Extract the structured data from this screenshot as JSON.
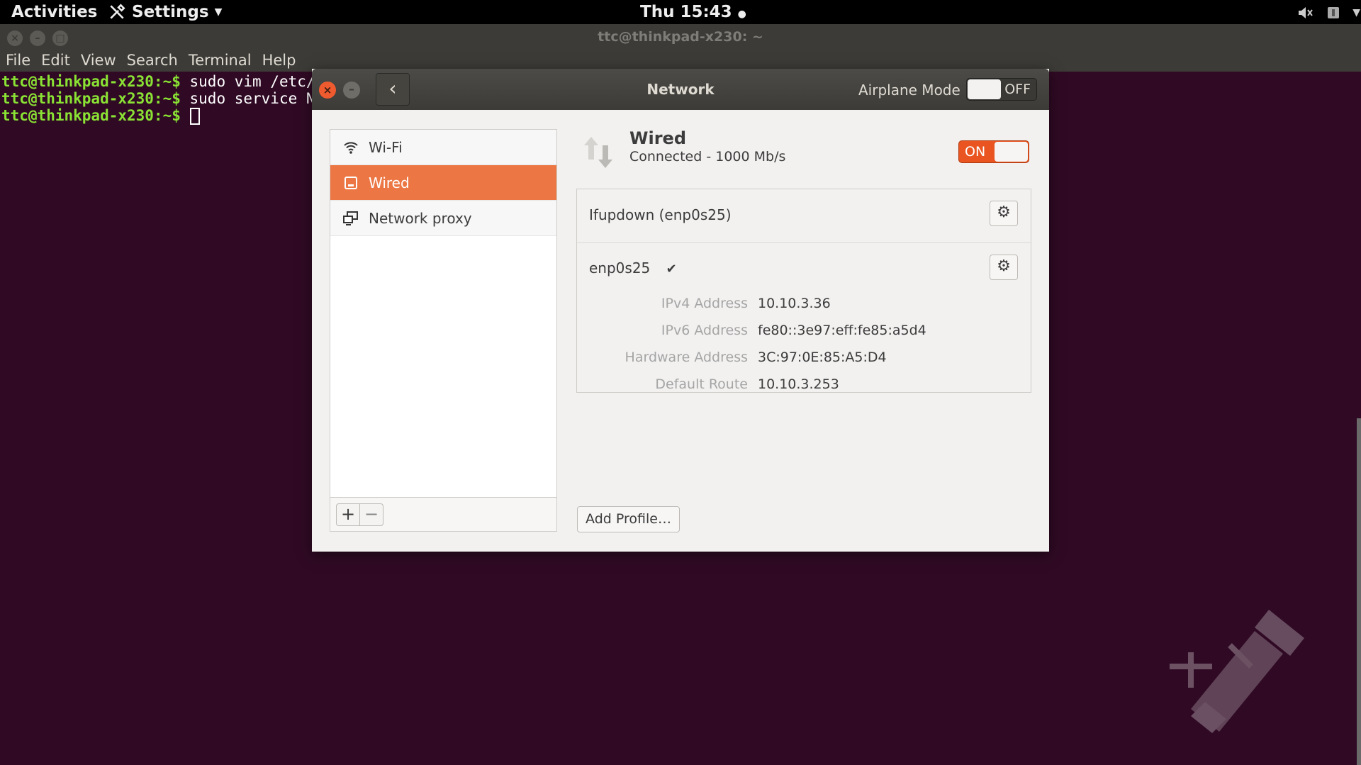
{
  "topbar": {
    "activities": "Activities",
    "app_menu": "Settings",
    "clock": "Thu 15:43",
    "clock_dot": "●"
  },
  "terminal": {
    "title": "ttc@thinkpad-x230: ~",
    "menu": [
      "File",
      "Edit",
      "View",
      "Search",
      "Terminal",
      "Help"
    ],
    "lines": [
      {
        "prompt": "ttc@thinkpad-x230:~$",
        "cmd": " sudo vim /etc/"
      },
      {
        "prompt": "ttc@thinkpad-x230:~$",
        "cmd": " sudo service N"
      },
      {
        "prompt": "ttc@thinkpad-x230:~$",
        "cmd": " "
      }
    ]
  },
  "dialog": {
    "title": "Network",
    "airplane_label": "Airplane Mode",
    "airplane_state": "OFF",
    "sidebar": [
      {
        "label": "Wi-Fi",
        "icon": "wifi-icon"
      },
      {
        "label": "Wired",
        "icon": "wired-icon"
      },
      {
        "label": "Network proxy",
        "icon": "network-proxy-icon"
      }
    ],
    "sidebar_add": "+",
    "sidebar_remove": "−",
    "wired": {
      "title": "Wired",
      "subtitle": "Connected - 1000 Mb/s",
      "state": "ON"
    },
    "profiles": [
      {
        "name": "Ifupdown (enp0s25)"
      },
      {
        "name": "enp0s25",
        "check": "✔"
      }
    ],
    "details": [
      {
        "key": "IPv4 Address",
        "value": "10.10.3.36"
      },
      {
        "key": "IPv6 Address",
        "value": "fe80::3e97:eff:fe85:a5d4"
      },
      {
        "key": "Hardware Address",
        "value": "3C:97:0E:85:A5:D4"
      },
      {
        "key": "Default Route",
        "value": "10.10.3.253"
      }
    ],
    "add_profile": "Add Profile…"
  },
  "colors": {
    "accent": "#e95420",
    "selection": "#ec7744",
    "terminal_bg": "#300a24",
    "prompt": "#8ae234"
  }
}
